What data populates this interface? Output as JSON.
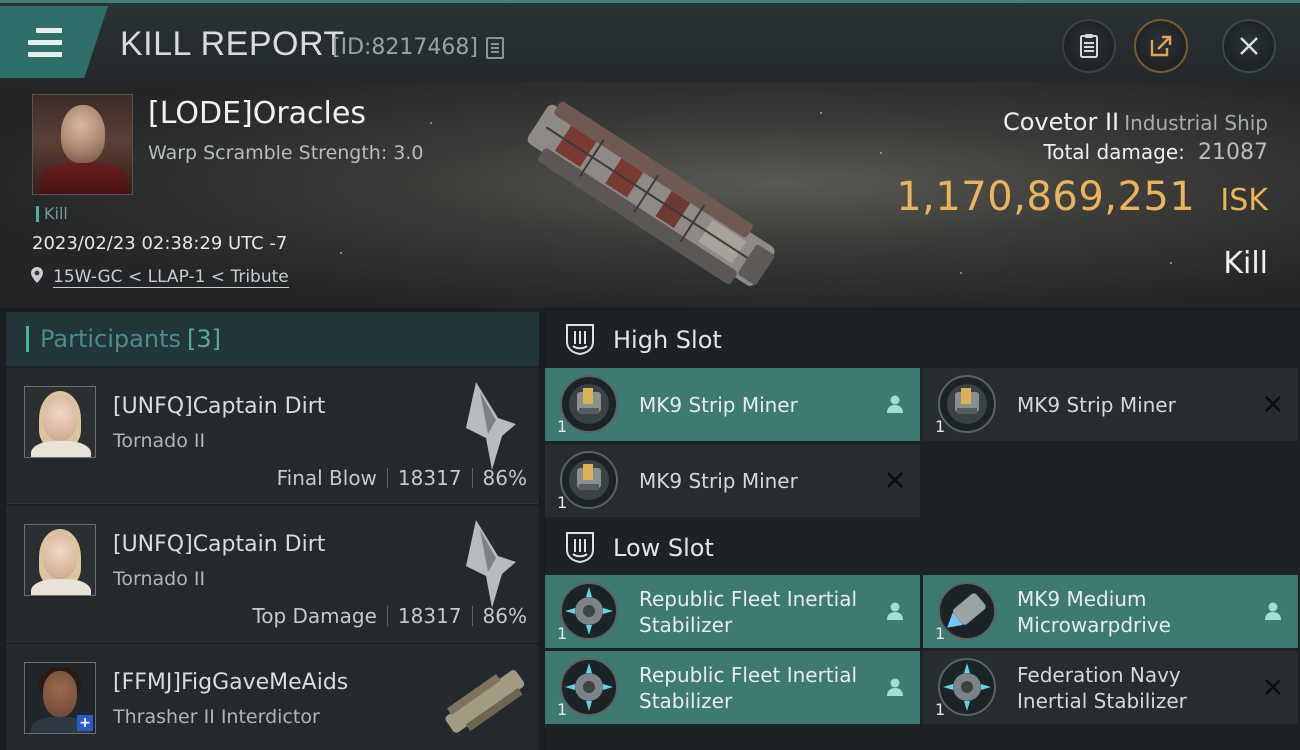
{
  "header": {
    "title": "KILL REPORT",
    "report_id": "[ID:8217468]"
  },
  "victim": {
    "name": "[LODE]Oracles",
    "subtitle": "Warp Scramble Strength: 3.0",
    "tag": "Kill",
    "datetime": "2023/02/23 02:38:29 UTC -7",
    "location": "15W-GC < LLAP-1 < Tribute",
    "ship_name": "Covetor II",
    "ship_class": "Industrial Ship",
    "total_damage_label": "Total damage:",
    "total_damage": "21087",
    "isk_value": "1,170,869,251",
    "isk_unit": "ISK",
    "result": "Kill"
  },
  "participants": {
    "title": "Participants",
    "count": "[3]",
    "rows": [
      {
        "name": "[UNFQ]Captain Dirt",
        "ship": "Tornado II",
        "role": "Final Blow",
        "damage": "18317",
        "percent": "86%"
      },
      {
        "name": "[UNFQ]Captain Dirt",
        "ship": "Tornado II",
        "role": "Top Damage",
        "damage": "18317",
        "percent": "86%"
      },
      {
        "name": "[FFMJ]FigGaveMeAids",
        "ship": "Thrasher II Interdictor"
      }
    ]
  },
  "fitting": {
    "high_slot_title": "High Slot",
    "low_slot_title": "Low Slot",
    "high": [
      {
        "name": "MK9 Strip Miner",
        "qty": "1",
        "status": "person-icon"
      },
      {
        "name": "MK9 Strip Miner",
        "qty": "1",
        "status": "destroyed-icon"
      },
      {
        "name": "MK9 Strip Miner",
        "qty": "1",
        "status": "destroyed-icon"
      }
    ],
    "low": [
      {
        "name": "Republic Fleet Inertial Stabilizer",
        "qty": "1",
        "status": "person-icon"
      },
      {
        "name": "MK9 Medium Microwarpdrive",
        "qty": "1",
        "status": "person-icon"
      },
      {
        "name": "Republic Fleet Inertial Stabilizer",
        "qty": "1",
        "status": "person-icon"
      },
      {
        "name": "Federation Navy Inertial Stabilizer",
        "qty": "1",
        "status": "destroyed-icon"
      }
    ]
  },
  "colors": {
    "accent": "#3d7a72",
    "isk": "#e8b55a",
    "header_teal": "#2f6f69"
  }
}
